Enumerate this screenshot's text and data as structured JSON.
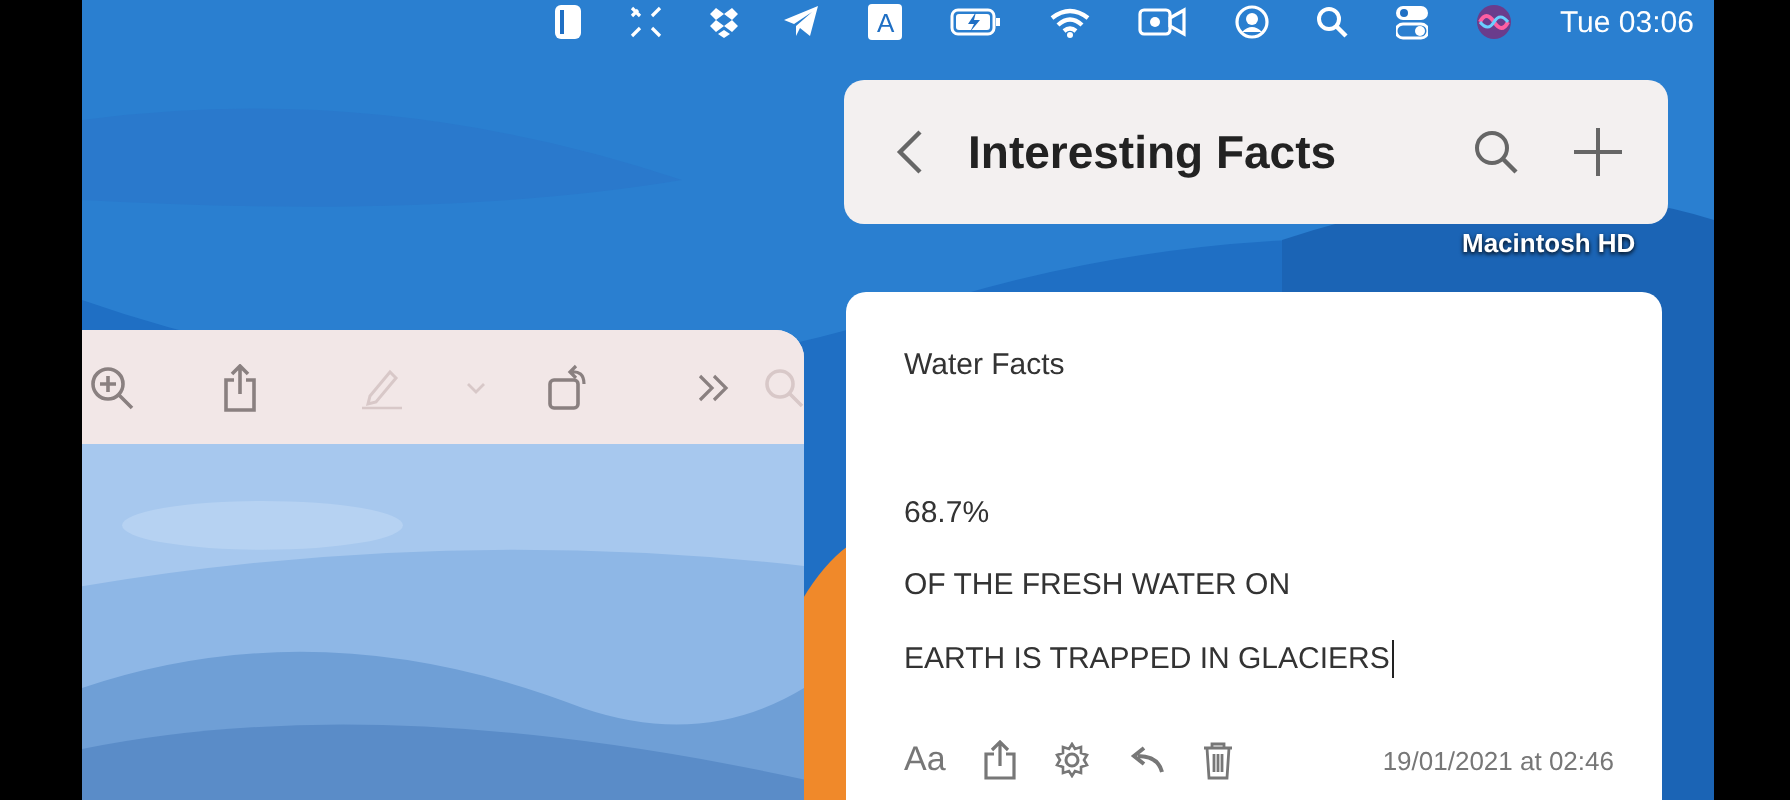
{
  "menu_bar": {
    "icons": [
      {
        "kind": "sidebar"
      },
      {
        "kind": "expand"
      },
      {
        "kind": "dropbox"
      },
      {
        "kind": "telegram"
      },
      {
        "kind": "input",
        "label": "A"
      },
      {
        "kind": "battery"
      },
      {
        "kind": "wifi"
      },
      {
        "kind": "camera"
      },
      {
        "kind": "user"
      },
      {
        "kind": "search"
      },
      {
        "kind": "control"
      },
      {
        "kind": "siri"
      }
    ],
    "clock": "Tue 03:06"
  },
  "preview_toolbar": [
    {
      "kind": "zoom-in",
      "disabled": false
    },
    {
      "kind": "share",
      "disabled": false
    },
    {
      "kind": "pencil",
      "disabled": true
    },
    {
      "kind": "chevron",
      "disabled": true
    },
    {
      "kind": "rotate",
      "disabled": false
    },
    {
      "kind": "more",
      "disabled": false
    },
    {
      "kind": "search",
      "disabled": true
    }
  ],
  "notes_header": {
    "title": "Interesting Facts"
  },
  "desktop_label": "Macintosh HD",
  "note": {
    "title": "Water Facts",
    "lines": [
      "68.7%",
      "OF THE FRESH WATER ON",
      "EARTH IS TRAPPED IN GLACIERS"
    ],
    "toolbar": [
      {
        "kind": "format",
        "label": "Aa"
      },
      {
        "kind": "share"
      },
      {
        "kind": "gear"
      },
      {
        "kind": "undo"
      },
      {
        "kind": "trash"
      }
    ],
    "timestamp": "19/01/2021 at 02:46"
  }
}
